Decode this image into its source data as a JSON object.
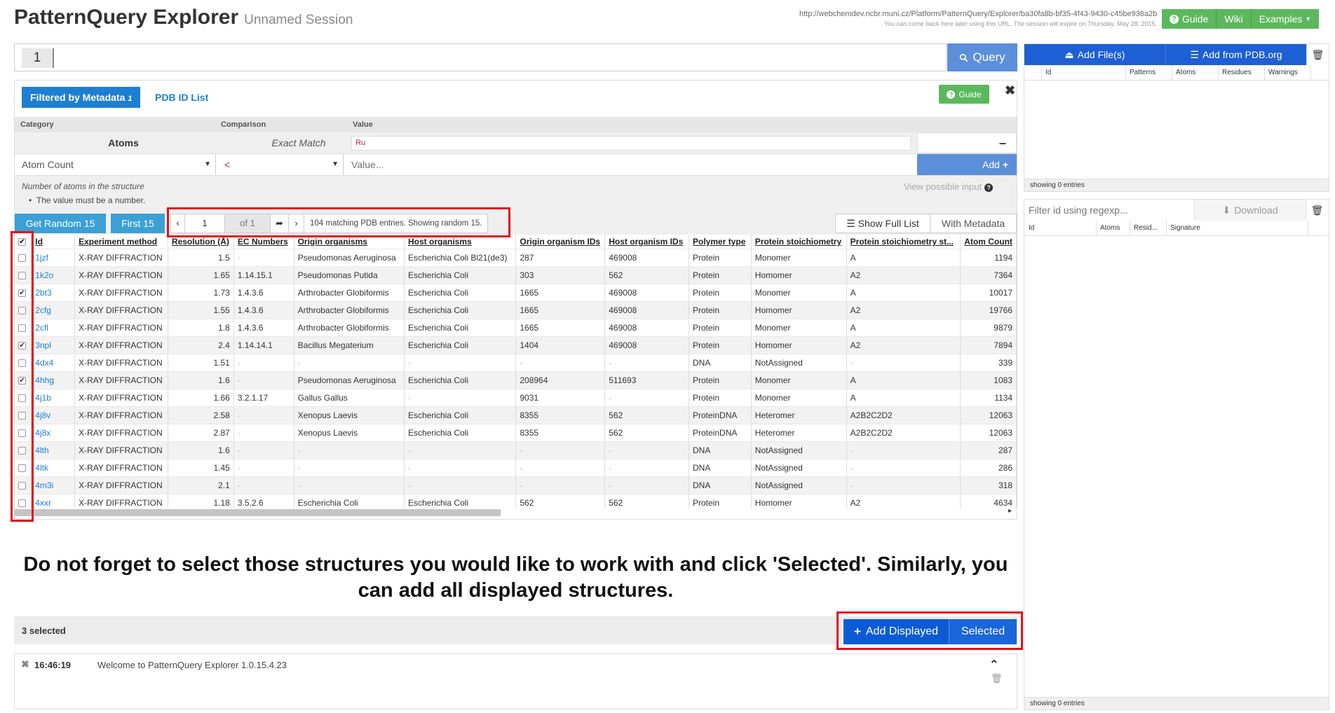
{
  "header": {
    "title": "PatternQuery Explorer",
    "subtitle": "Unnamed Session",
    "session_url": "http://webchemdev.ncbr.muni.cz/Platform/PatternQuery/Explorer/ba30fa8b-bf35-4f43-9430-c45be936a2b",
    "session_note": "You can come back here later using this URL. The session will expire on Thursday, May 28, 2015.",
    "buttons": {
      "guide": "Guide",
      "wiki": "Wiki",
      "examples": "Examples"
    }
  },
  "query": {
    "line_number": "1",
    "button": "Query"
  },
  "metadata": {
    "tab_active": "Filtered by Metadata",
    "tab_badge": "1",
    "tab_pdb": "PDB ID List",
    "guide": "Guide",
    "columns": {
      "category": "Category",
      "comparison": "Comparison",
      "value": "Value"
    },
    "filter": {
      "category": "Atoms",
      "comparison": "Exact Match",
      "value": "Ru"
    },
    "new_filter": {
      "category": "Atom Count",
      "comparison": "<",
      "value_placeholder": "Value...",
      "add": "Add"
    },
    "help_text": "Number of atoms in the structure",
    "help_bullet": "The value must be a number.",
    "possible_input": "View possible input"
  },
  "toolbar": {
    "get_random": "Get Random 15",
    "first": "First 15",
    "page": "1",
    "of": "of 1",
    "info": "104 matching PDB entries. Showing random 15.",
    "show_full": "Show Full List",
    "with_metadata": "With Metadata"
  },
  "table": {
    "headers": [
      "Id",
      "Experiment method",
      "Resolution (Å)",
      "EC Numbers",
      "Origin organisms",
      "Host organisms",
      "Origin organism IDs",
      "Host organism IDs",
      "Polymer type",
      "Protein stoichiometry",
      "Protein stoichiometry st...",
      "Atom Count"
    ],
    "rows": [
      {
        "checked": false,
        "id": "1jzf",
        "method": "X-RAY DIFFRACTION",
        "res": "1.5",
        "ec": "-",
        "origin": "Pseudomonas Aeruginosa",
        "host": "Escherichia Coli Bl21(de3)",
        "origin_id": "287",
        "host_id": "469008",
        "polymer": "Protein",
        "stoich": "Monomer",
        "stoich_st": "A",
        "atoms": "1194"
      },
      {
        "checked": false,
        "id": "1k2o",
        "method": "X-RAY DIFFRACTION",
        "res": "1.65",
        "ec": "1.14.15.1",
        "origin": "Pseudomonas Putida",
        "host": "Escherichia Coli",
        "origin_id": "303",
        "host_id": "562",
        "polymer": "Protein",
        "stoich": "Homomer",
        "stoich_st": "A2",
        "atoms": "7364"
      },
      {
        "checked": true,
        "id": "2bt3",
        "method": "X-RAY DIFFRACTION",
        "res": "1.73",
        "ec": "1.4.3.6",
        "origin": "Arthrobacter Globiformis",
        "host": "Escherichia Coli",
        "origin_id": "1665",
        "host_id": "469008",
        "polymer": "Protein",
        "stoich": "Monomer",
        "stoich_st": "A",
        "atoms": "10017"
      },
      {
        "checked": false,
        "id": "2cfg",
        "method": "X-RAY DIFFRACTION",
        "res": "1.55",
        "ec": "1.4.3.6",
        "origin": "Arthrobacter Globiformis",
        "host": "Escherichia Coli",
        "origin_id": "1665",
        "host_id": "469008",
        "polymer": "Protein",
        "stoich": "Homomer",
        "stoich_st": "A2",
        "atoms": "19766"
      },
      {
        "checked": false,
        "id": "2cfl",
        "method": "X-RAY DIFFRACTION",
        "res": "1.8",
        "ec": "1.4.3.6",
        "origin": "Arthrobacter Globiformis",
        "host": "Escherichia Coli",
        "origin_id": "1665",
        "host_id": "469008",
        "polymer": "Protein",
        "stoich": "Monomer",
        "stoich_st": "A",
        "atoms": "9879"
      },
      {
        "checked": true,
        "id": "3npl",
        "method": "X-RAY DIFFRACTION",
        "res": "2.4",
        "ec": "1.14.14.1",
        "origin": "Bacillus Megaterium",
        "host": "Escherichia Coli",
        "origin_id": "1404",
        "host_id": "469008",
        "polymer": "Protein",
        "stoich": "Homomer",
        "stoich_st": "A2",
        "atoms": "7894"
      },
      {
        "checked": false,
        "id": "4dx4",
        "method": "X-RAY DIFFRACTION",
        "res": "1.51",
        "ec": "-",
        "origin": "-",
        "host": "-",
        "origin_id": "-",
        "host_id": "-",
        "polymer": "DNA",
        "stoich": "NotAssigned",
        "stoich_st": "-",
        "atoms": "339"
      },
      {
        "checked": true,
        "id": "4hhg",
        "method": "X-RAY DIFFRACTION",
        "res": "1.6",
        "ec": "-",
        "origin": "Pseudomonas Aeruginosa",
        "host": "Escherichia Coli",
        "origin_id": "208964",
        "host_id": "511693",
        "polymer": "Protein",
        "stoich": "Monomer",
        "stoich_st": "A",
        "atoms": "1083"
      },
      {
        "checked": false,
        "id": "4j1b",
        "method": "X-RAY DIFFRACTION",
        "res": "1.66",
        "ec": "3.2.1.17",
        "origin": "Gallus Gallus",
        "host": "-",
        "origin_id": "9031",
        "host_id": "-",
        "polymer": "Protein",
        "stoich": "Monomer",
        "stoich_st": "A",
        "atoms": "1134"
      },
      {
        "checked": false,
        "id": "4j8v",
        "method": "X-RAY DIFFRACTION",
        "res": "2.58",
        "ec": "-",
        "origin": "Xenopus Laevis",
        "host": "Escherichia Coli",
        "origin_id": "8355",
        "host_id": "562",
        "polymer": "ProteinDNA",
        "stoich": "Heteromer",
        "stoich_st": "A2B2C2D2",
        "atoms": "12063"
      },
      {
        "checked": false,
        "id": "4j8x",
        "method": "X-RAY DIFFRACTION",
        "res": "2.87",
        "ec": "-",
        "origin": "Xenopus Laevis",
        "host": "Escherichia Coli",
        "origin_id": "8355",
        "host_id": "562",
        "polymer": "ProteinDNA",
        "stoich": "Heteromer",
        "stoich_st": "A2B2C2D2",
        "atoms": "12063"
      },
      {
        "checked": false,
        "id": "4lth",
        "method": "X-RAY DIFFRACTION",
        "res": "1.6",
        "ec": "-",
        "origin": "-",
        "host": "-",
        "origin_id": "-",
        "host_id": "-",
        "polymer": "DNA",
        "stoich": "NotAssigned",
        "stoich_st": "-",
        "atoms": "287"
      },
      {
        "checked": false,
        "id": "4ltk",
        "method": "X-RAY DIFFRACTION",
        "res": "1.45",
        "ec": "-",
        "origin": "-",
        "host": "-",
        "origin_id": "-",
        "host_id": "-",
        "polymer": "DNA",
        "stoich": "NotAssigned",
        "stoich_st": "-",
        "atoms": "286"
      },
      {
        "checked": false,
        "id": "4m3i",
        "method": "X-RAY DIFFRACTION",
        "res": "2.1",
        "ec": "-",
        "origin": "-",
        "host": "-",
        "origin_id": "-",
        "host_id": "-",
        "polymer": "DNA",
        "stoich": "NotAssigned",
        "stoich_st": "-",
        "atoms": "318"
      },
      {
        "checked": false,
        "id": "4xxr",
        "method": "X-RAY DIFFRACTION",
        "res": "1.18",
        "ec": "3.5.2.6",
        "origin": "Escherichia Coli",
        "host": "Escherichia Coli",
        "origin_id": "562",
        "host_id": "562",
        "polymer": "Protein",
        "stoich": "Homomer",
        "stoich_st": "A2",
        "atoms": "4634"
      }
    ]
  },
  "note": "Do not forget to select those structures you would like to work with and click 'Selected'. Similarly, you can add all displayed structures.",
  "selection": {
    "count": "3 selected",
    "add_displayed": "Add Displayed",
    "selected": "Selected"
  },
  "log": {
    "time": "16:46:19",
    "message": "Welcome to PatternQuery Explorer 1.0.15.4.23"
  },
  "right": {
    "add_files": "Add File(s)",
    "add_pdb": "Add from PDB.org",
    "cols": [
      "Id",
      "Patterns",
      "Atoms",
      "Residues",
      "Warnings"
    ],
    "footer": "showing 0 entries",
    "filter_placeholder": "Filter id using regexp...",
    "download": "Download",
    "cols2": [
      "Id",
      "Atoms",
      "Resid...",
      "Signature"
    ],
    "footer2": "showing 0 entries"
  },
  "colors": {
    "primary_blue": "#1d7fd1",
    "green": "#5cb85c",
    "annotation_red": "#e0101a"
  }
}
